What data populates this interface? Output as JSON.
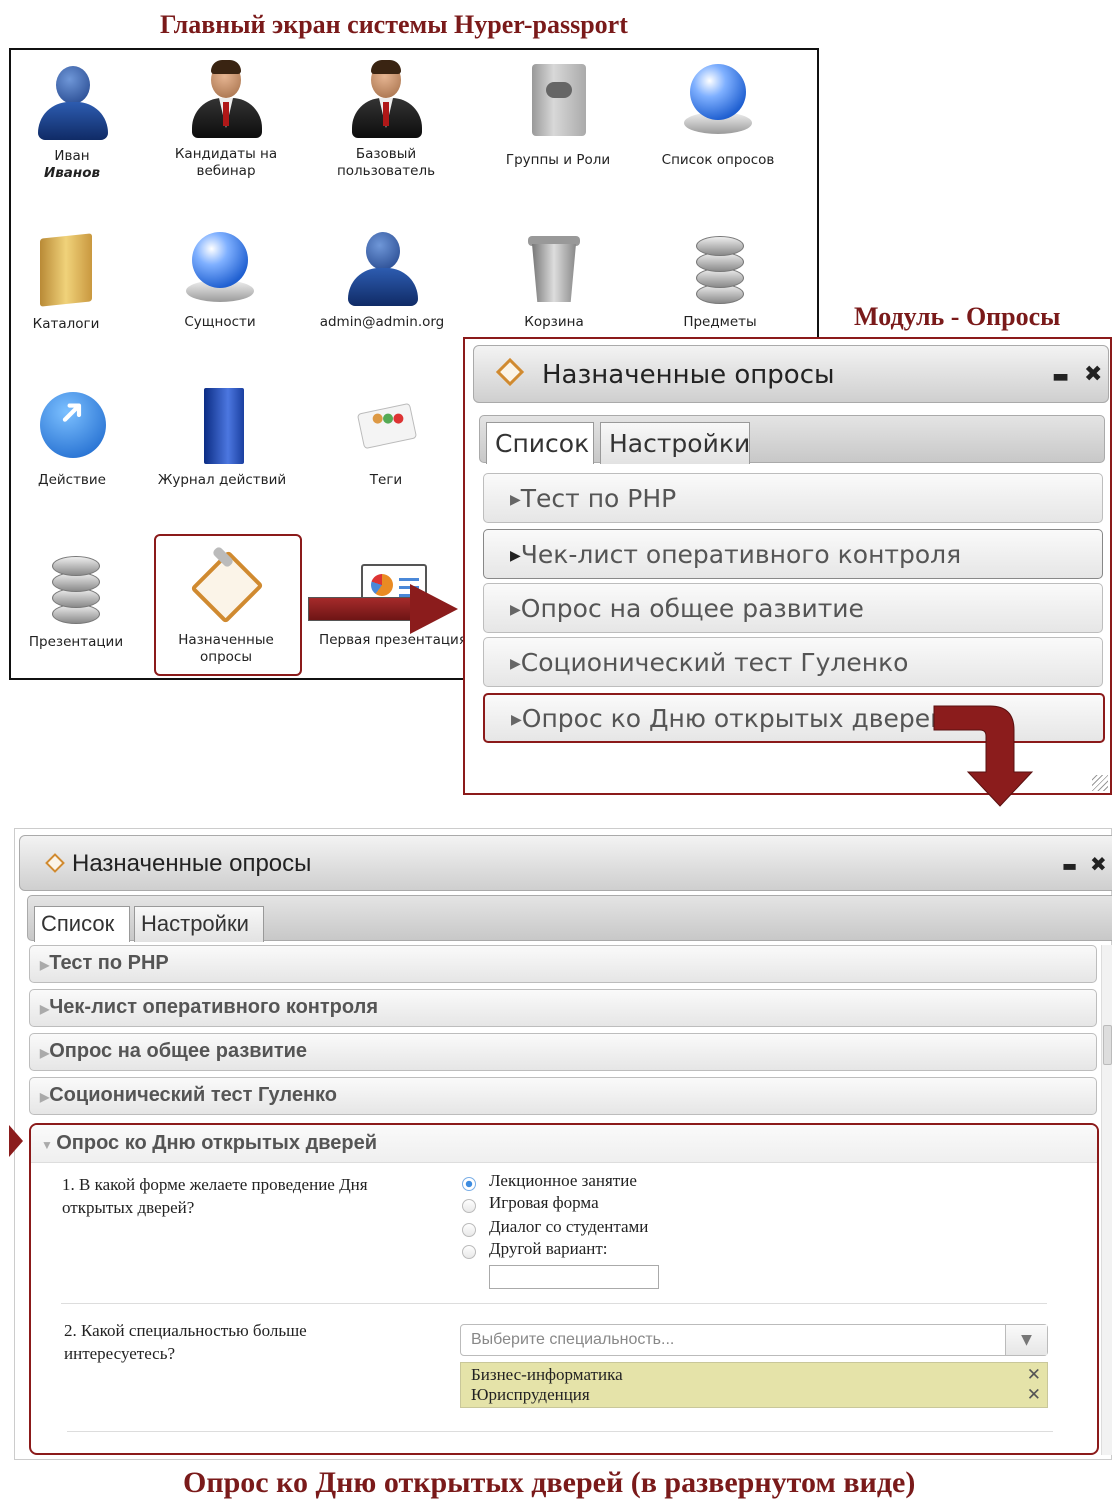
{
  "captions": {
    "top": "Главный экран системы Hyper-passport",
    "module": "Модуль - Опросы",
    "bottom": "Опрос ко Дню открытых дверей (в развернутом виде)"
  },
  "desktop": {
    "icons": [
      {
        "line1": "Иван",
        "line2": "Иванов"
      },
      {
        "line1": "Кандидаты на",
        "line2": "вебинар"
      },
      {
        "line1": "Базовый",
        "line2": "пользователь"
      },
      {
        "line1": "Группы и Роли"
      },
      {
        "line1": "Список опросов"
      },
      {
        "line1": "Каталоги"
      },
      {
        "line1": "Сущности"
      },
      {
        "line1": "admin@admin.org"
      },
      {
        "line1": "Корзина"
      },
      {
        "line1": "Предметы"
      },
      {
        "line1": "Действие"
      },
      {
        "line1": "Журнал действий"
      },
      {
        "line1": "Теги"
      },
      {
        "line1": "Презентации"
      },
      {
        "line1": "Назначенные",
        "line2": "опросы"
      },
      {
        "line1": "Первая презентация"
      }
    ]
  },
  "module_window": {
    "title": "Назначенные опросы",
    "minimize": "▬",
    "close": "✖",
    "tabs": [
      "Список",
      "Настройки"
    ],
    "items": [
      "Тест по PHP",
      "Чек-лист оперативного контроля",
      "Опрос на общее развитие",
      "Соционический тест Гуленко",
      "Опрос ко Дню открытых дверей"
    ]
  },
  "expanded_window": {
    "title": "Назначенные опросы",
    "minimize": "▬",
    "close": "✖",
    "tabs": [
      "Список",
      "Настройки"
    ],
    "items": [
      "Тест по PHP",
      "Чек-лист оперативного контроля",
      "Опрос на общее развитие",
      "Соционический тест Гуленко"
    ],
    "open_item": "Опрос ко Дню открытых дверей",
    "q1": {
      "text": "1. В какой форме желаете проведение Дня открытых дверей?",
      "options": [
        "Лекционное занятие",
        "Игровая форма",
        "Диалог со студентами",
        "Другой вариант:"
      ],
      "selected": 0,
      "other_value": ""
    },
    "q2": {
      "text": "2. Какой специальностью больше интересуетесь?",
      "placeholder": "Выберите специальность...",
      "chosen": [
        "Бизнес-информатика",
        "Юриспруденция"
      ],
      "remove": "✕"
    }
  },
  "colors": {
    "accent": "#8b1a1a",
    "chip_bg": "#e5e3a9",
    "radio_on": "#3d8ce0"
  }
}
